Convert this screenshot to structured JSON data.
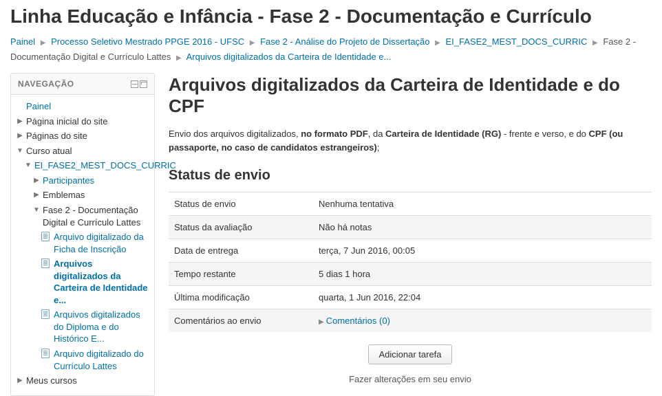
{
  "page_title": "Linha Educação e Infância - Fase 2 - Documentação e Currículo",
  "breadcrumb": {
    "items": [
      "Painel",
      "Processo Seletivo Mestrado PPGE 2016 - UFSC",
      "Fase 2 - Análise do Projeto de Dissertação",
      "EI_FASE2_MEST_DOCS_CURRIC"
    ],
    "tail_plain": "Fase 2 - Documentação Digital e Currículo Lattes",
    "tail_link": "Arquivos digitalizados da Carteira de Identidade e..."
  },
  "nav": {
    "title": "NAVEGAÇÃO",
    "painel": "Painel",
    "site_home": "Página inicial do site",
    "site_pages": "Páginas do site",
    "current_course": "Curso atual",
    "course_short": "EI_FASE2_MEST_DOCS_CURRIC",
    "participants": "Participantes",
    "badges": "Emblemas",
    "section": "Fase 2 - Documentação Digital e Currículo Lattes",
    "activities": [
      "Arquivo digitalizado da Ficha de Inscrição",
      "Arquivos digitalizados da Carteira de Identidade e...",
      "Arquivos digitalizados do Diploma e do Histórico E...",
      "Arquivo digitalizado do Currículo Lattes"
    ],
    "my_courses": "Meus cursos"
  },
  "main": {
    "heading": "Arquivos digitalizados da Carteira de Identidade e do CPF",
    "intro_pre": "Envio dos arquivos digitalizados, ",
    "intro_b1": "no formato PDF",
    "intro_mid1": ", da ",
    "intro_b2": "Carteira de Identidade (RG)",
    "intro_mid2": " - frente e verso, e do ",
    "intro_b3": "CPF (ou passaporte, no caso de candidatos estrangeiros)",
    "intro_end": ";",
    "status_heading": "Status de envio",
    "rows": {
      "r1_label": "Status de envio",
      "r1_value": "Nenhuma tentativa",
      "r2_label": "Status da avaliação",
      "r2_value": "Não há notas",
      "r3_label": "Data de entrega",
      "r3_value": "terça, 7 Jun 2016, 00:05",
      "r4_label": "Tempo restante",
      "r4_value": "5 dias 1 hora",
      "r5_label": "Última modificação",
      "r5_value": "quarta, 1 Jun 2016, 22:04",
      "r6_label": "Comentários ao envio",
      "r6_value": "Comentários (0)"
    },
    "button": "Adicionar tarefa",
    "note": "Fazer alterações em seu envio"
  }
}
